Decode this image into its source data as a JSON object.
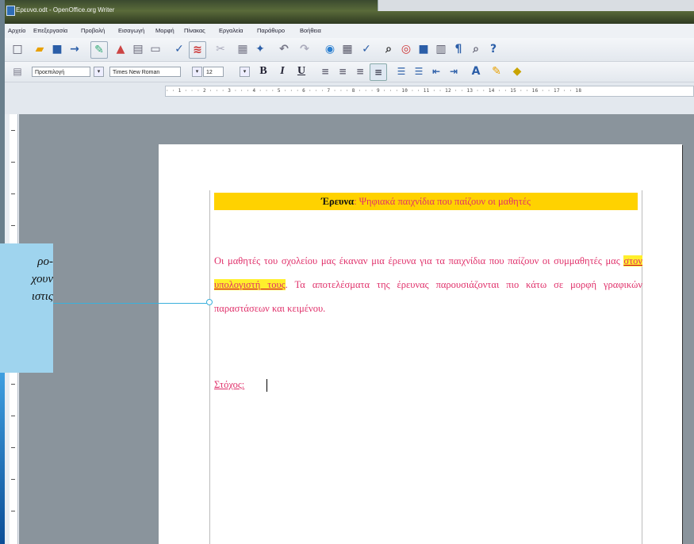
{
  "window": {
    "title": "Ερευνα.odt - OpenOffice.org Writer"
  },
  "menu": {
    "items": [
      "Αρχείο",
      "Επεξεργασία",
      "Προβολή",
      "Εισαγωγή",
      "Μορφή",
      "Πίνακας",
      "Εργαλεία",
      "Παράθυρο",
      "Βοήθεια"
    ]
  },
  "format_toolbar": {
    "style": "Προεπιλογή",
    "font": "Times New Roman",
    "size": "12",
    "bold_label": "B",
    "italic_label": "I",
    "underline_label": "U"
  },
  "ruler": {
    "text": "· · 1 · · · 2 · · · 3 · · · 4 · · · 5 · · · 6 · · · 7 · · · 8 · · · 9 · · · 10 · · 11 · · 12 · · 13 · · 14 · · 15 · · 16 · · 17 · · 18"
  },
  "document": {
    "title_bold": "Έρευνα",
    "title_rest": ": Ψηφιακά παιχνίδια που παίζουν οι μαθητές",
    "para_1": "Οι μαθητές του σχολείου μας έκαναν μια έρευνα για τα παιχνίδια που παίζουν οι συμμαθητές μας ",
    "para_highlight": "στον υπολογιστή τους",
    "para_2": ". Τα αποτελέσματα της έρευνας παρουσιάζονται πιο κάτω σε μορφή γραφικών παραστάσεων και κειμένου.",
    "goal_label": "Στόχος:"
  },
  "callout": {
    "text": "ρο-\nχουν\nιστις"
  },
  "colors": {
    "accent_pink": "#e0306a",
    "title_band": "#ffd200",
    "callout_bg": "#9fd4ee"
  }
}
